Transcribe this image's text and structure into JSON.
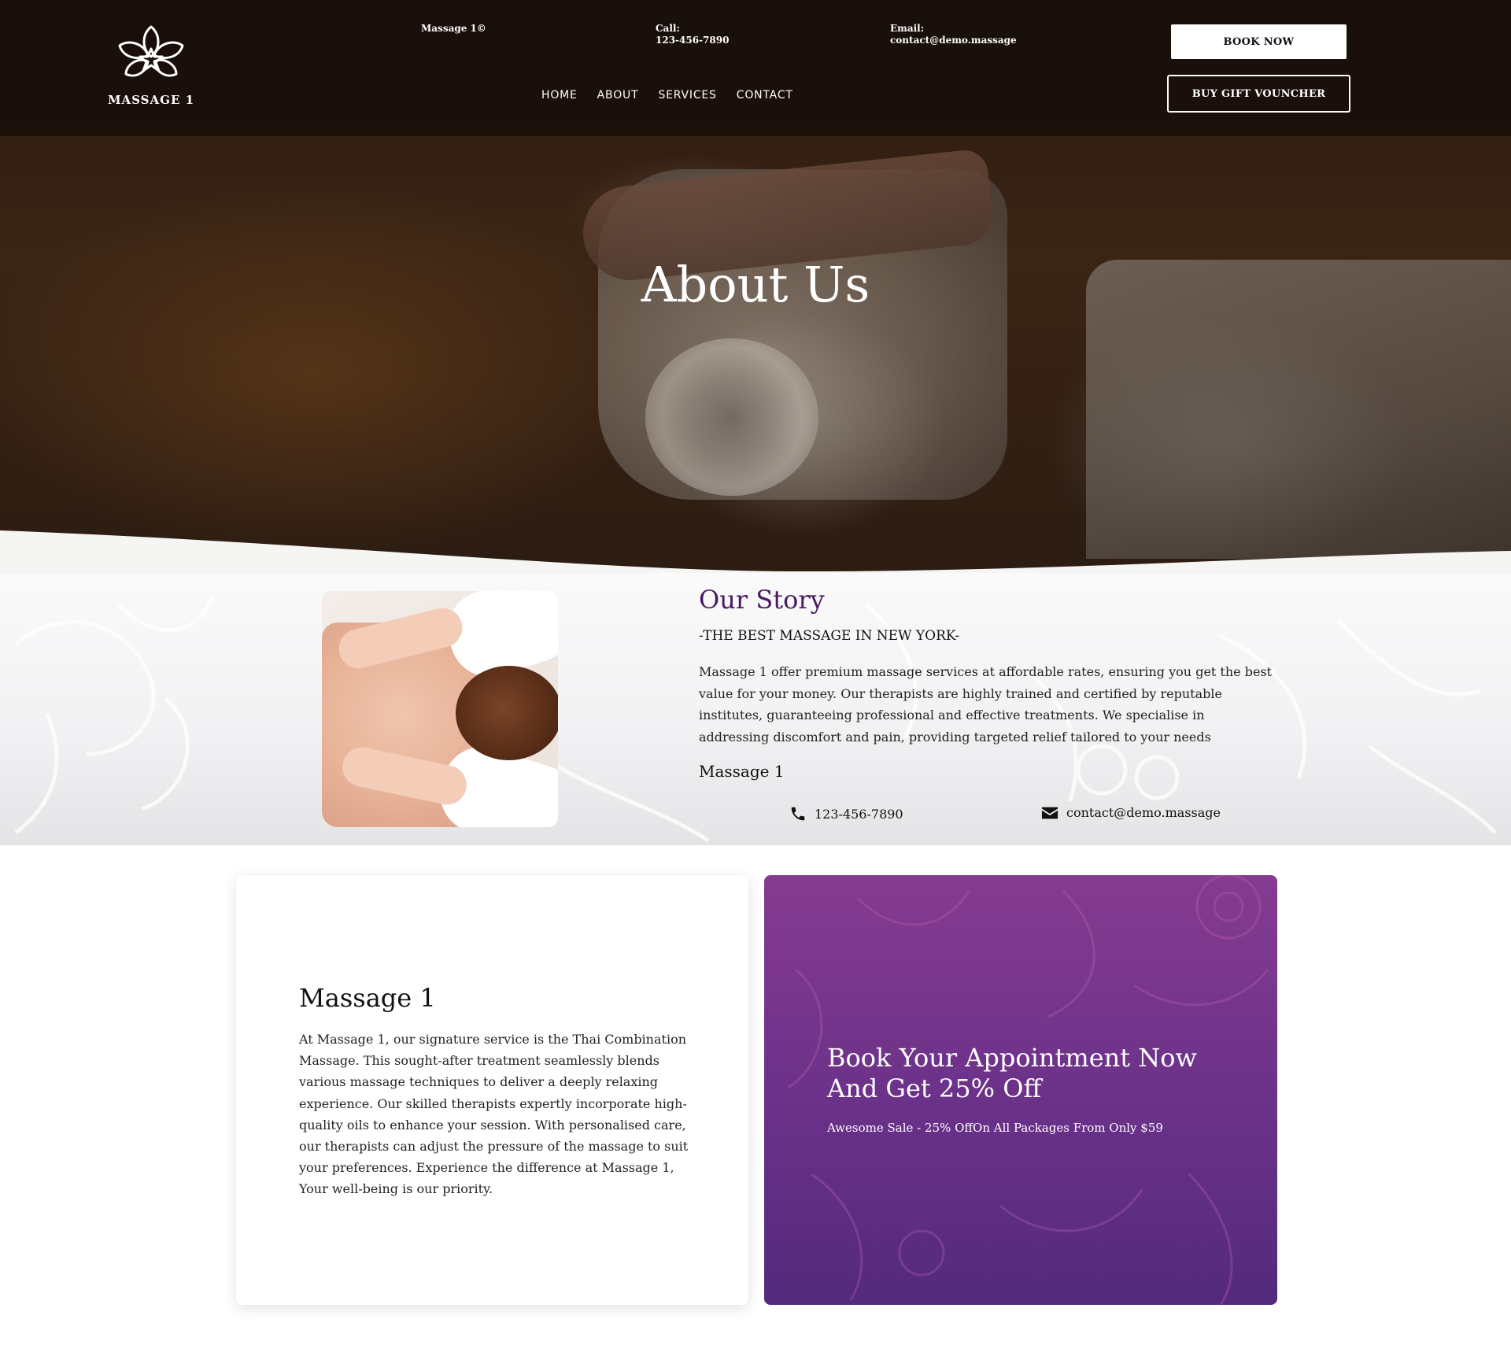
{
  "brand": {
    "logo_text": "MASSAGE 1",
    "copyright": "Massage 1©"
  },
  "header": {
    "call_label": "Call:",
    "call_value": "123-456-7890",
    "email_label": "Email:",
    "email_value": "contact@demo.massage",
    "book_button": "BOOK NOW",
    "gift_button": "BUY GIFT VOUNCHER"
  },
  "nav": {
    "items": [
      {
        "label": "HOME"
      },
      {
        "label": "ABOUT"
      },
      {
        "label": "SERVICES"
      },
      {
        "label": "CONTACT"
      }
    ]
  },
  "hero": {
    "title": "About Us"
  },
  "story": {
    "title": "Our Story",
    "subtitle": "-THE BEST MASSAGE IN NEW YORK-",
    "text": "Massage 1 offer premium massage services at affordable rates, ensuring you get the best value for your money. Our therapists are highly trained and certified by reputable institutes, guaranteeing professional and effective treatments. We specialise in addressing discomfort and pain, providing targeted relief tailored to your needs",
    "signature": "Massage 1",
    "phone": "123-456-7890",
    "email": "contact@demo.massage"
  },
  "card_left": {
    "title": "Massage 1",
    "text": "At Massage 1, our signature service is the Thai Combination Massage. This sought-after treatment seamlessly blends various massage techniques to deliver a deeply relaxing experience. Our skilled therapists expertly incorporate high-quality oils to enhance your session. With personalised care, our therapists can adjust the pressure of the massage to suit your preferences. Experience the difference at Massage 1, Your well-being is our priority."
  },
  "card_right": {
    "title": "Book Your Appointment Now And Get 25% Off",
    "text": "Awesome Sale - 25% OffOn All Packages From Only $59"
  },
  "colors": {
    "accent_purple": "#4a1a5e",
    "promo_top": "#853b90",
    "promo_bottom": "#532a7c",
    "header_overlay": "#140c08"
  },
  "icons": {
    "logo": "lotus-icon",
    "phone": "phone-icon",
    "mail": "envelope-icon"
  }
}
